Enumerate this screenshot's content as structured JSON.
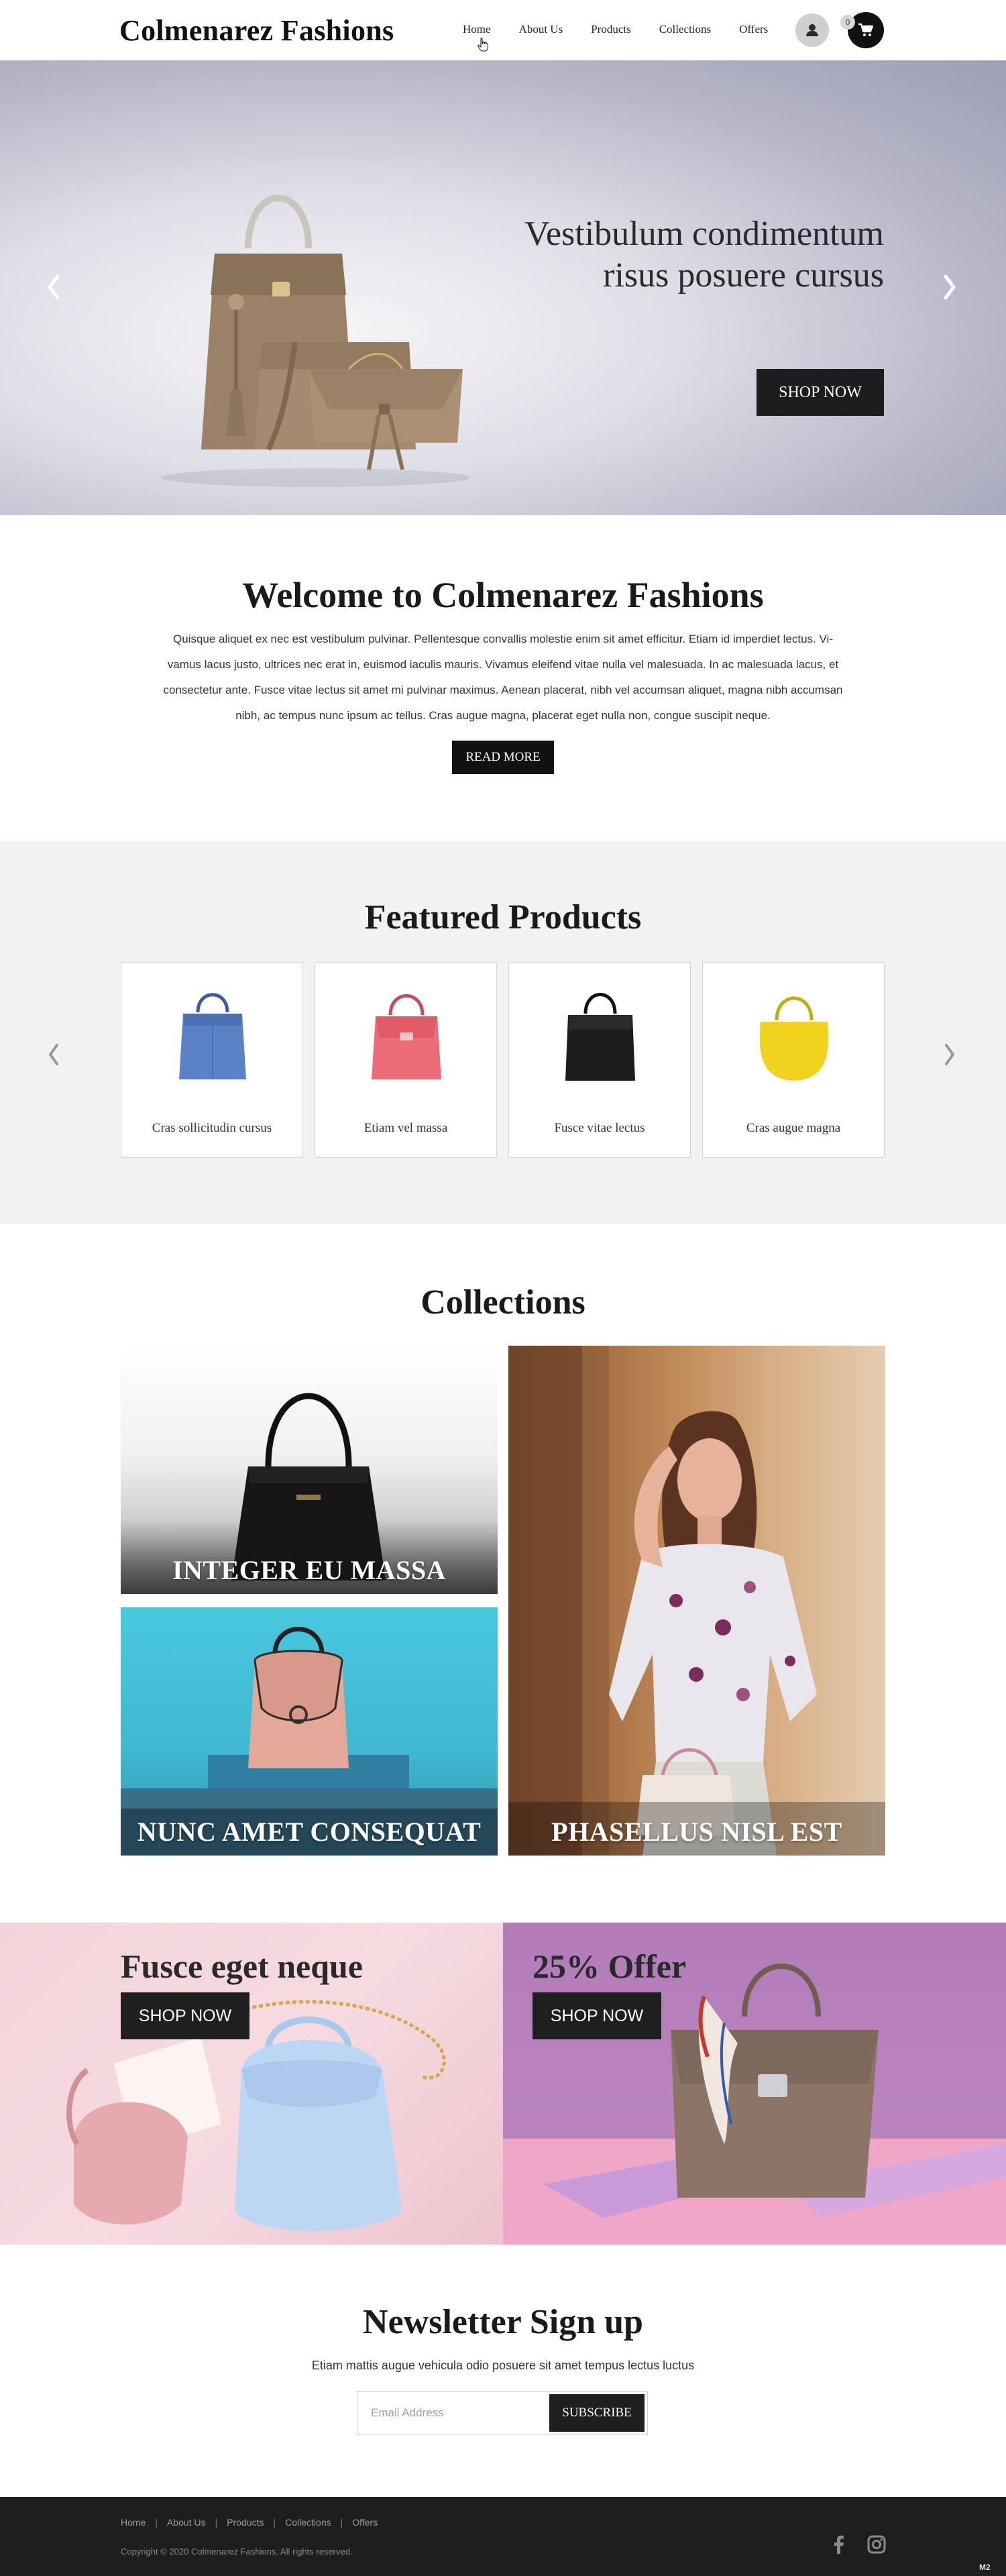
{
  "header": {
    "logo": "Colmenarez Fashions",
    "nav": [
      "Home",
      "About Us",
      "Products",
      "Collections",
      "Offers"
    ],
    "cart_count": "0"
  },
  "hero": {
    "title_line1": "Vestibulum condimentum",
    "title_line2": "risus posuere cursus",
    "cta": "SHOP NOW"
  },
  "welcome": {
    "title": "Welcome to Colmenarez Fashions",
    "lines": [
      "Quisque aliquet ex nec est vestibulum pulvinar. Pellentesque convallis molestie enim sit amet efficitur. Etiam id imperdiet lectus. Vi-",
      "vamus lacus justo, ultrices nec erat in, euismod iaculis mauris. Vivamus eleifend vitae nulla vel malesuada. In ac malesuada lacus, et",
      "consectetur ante. Fusce vitae lectus sit amet mi pulvinar maximus. Aenean placerat, nibh vel accumsan aliquet, magna nibh accumsan",
      "nibh, ac tempus nunc ipsum ac tellus. Cras augue magna, placerat eget nulla non, congue suscipit neque."
    ],
    "cta": "READ MORE"
  },
  "featured": {
    "title": "Featured Products",
    "products": [
      {
        "name": "Cras sollicitudin cursus",
        "color": "#5b82c6"
      },
      {
        "name": "Etiam vel massa",
        "color": "#ee6b78"
      },
      {
        "name": "Fusce vitae lectus",
        "color": "#1c1c1e"
      },
      {
        "name": "Cras augue magna",
        "color": "#f0d21f"
      }
    ]
  },
  "collections": {
    "title": "Collections",
    "tiles": [
      "INTEGER EU MASSA",
      "NUNC AMET CONSEQUAT",
      "PHASELLUS NISL EST"
    ]
  },
  "promos": [
    {
      "title": "Fusce eget neque",
      "cta": "SHOP NOW"
    },
    {
      "title": "25% Offer",
      "cta": "SHOP NOW"
    }
  ],
  "newsletter": {
    "title": "Newsletter Sign up",
    "subtitle": "Etiam mattis augue vehicula odio posuere sit amet tempus lectus luctus",
    "placeholder": "Email Address",
    "cta": "SUBSCRIBE"
  },
  "footer": {
    "links": [
      "Home",
      "About Us",
      "Products",
      "Collections",
      "Offers"
    ],
    "copyright": "Copyright  ©  2020   Colmenarez Fashions.   All rights reserved.",
    "badge": "M2"
  },
  "icons": {
    "user": "user-icon",
    "cart": "cart-icon",
    "prev": "chevron-left-icon",
    "next": "chevron-right-icon",
    "facebook": "facebook-icon",
    "instagram": "instagram-icon"
  }
}
